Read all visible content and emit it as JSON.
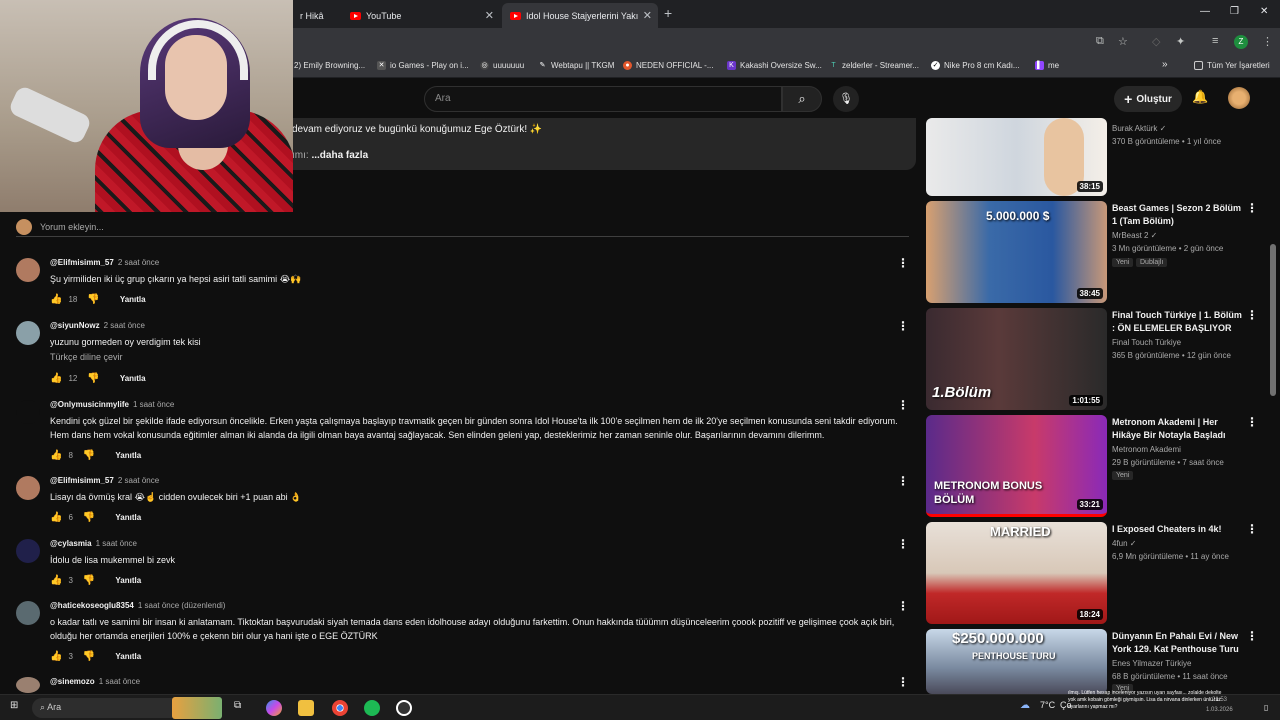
{
  "browser": {
    "tabs": [
      {
        "label": "r Hikâ"
      },
      {
        "label": "YouTube"
      },
      {
        "label": "Idol House Stajyerlerini Yakında"
      }
    ],
    "new_tab": "+",
    "bookmarks": [
      "2) Emily Browning...",
      "io Games - Play on i...",
      "uuuuuuu",
      "Webtapu || TKGM",
      "NEDEN OFFICIAL -...",
      "Kakashi Oversize Sw...",
      "zelderler - Streamer...",
      "Nike Pro 8 cm Kadı...",
      "me"
    ],
    "bookmarks_more": "»",
    "all_bookmarks": "Tüm Yer İşaretleri",
    "profile_letter": "Z"
  },
  "youtube": {
    "search_placeholder": "Ara",
    "create_label": "Oluştur",
    "description_line": "devam ediyoruz ve bugünkü konuğumuz Ege Öztürk! ✨",
    "description_more_prefix": "ımı: ",
    "description_more": "...daha fazla",
    "add_comment": "Yorum ekleyin...",
    "comments": [
      {
        "user": "@Elifmisimm_57",
        "time": "2 saat önce",
        "text": "Şu yirmiliden iki üç grup çıkarın ya hepsi asiri tatli samimi 😭🙌",
        "likes": "18",
        "reply": "Yanıtla",
        "avatar": "#b07a60"
      },
      {
        "user": "@siyunNowz",
        "time": "2 saat önce",
        "text": "yuzunu gormeden oy verdigim tek kisi",
        "translate": "Türkçe diline çevir",
        "likes": "12",
        "reply": "Yanıtla",
        "avatar": "#8aa0a8"
      },
      {
        "user": "@Onlymusicinmylife",
        "time": "1 saat önce",
        "text": "Kendini çok güzel bir şekilde ifade ediyorsun öncelikle. Erken yaşta çalışmaya başlayıp travmatik geçen bir günden sonra Idol House'ta ilk 100'e seçilmen hem de ilk 20'ye seçilmen konusunda seni takdir ediyorum. Hem dans hem vokal konusunda eğitimler alman iki alanda da ilgili olman baya avantaj sağlayacak. Sen elinden geleni yap, desteklerimiz her zaman seninle olur. Başarılarının devamını dilerimm.",
        "likes": "8",
        "reply": "Yanıtla",
        "avatar": "#0f0f0f"
      },
      {
        "user": "@Elifmisimm_57",
        "time": "2 saat önce",
        "text": "Lisayı da övmüş kral 😭☝️ cidden ovulecek biri +1 puan abi 👌",
        "likes": "6",
        "reply": "Yanıtla",
        "avatar": "#b07a60"
      },
      {
        "user": "@cylasmia",
        "time": "1 saat önce",
        "text": "İdolu de lisa mukemmel bi zevk",
        "likes": "3",
        "reply": "Yanıtla",
        "avatar": "#20204a"
      },
      {
        "user": "@haticekoseoglu8354",
        "time": "1 saat önce (düzenlendi)",
        "text": "o kadar tatlı ve samimi bir insan ki anlatamam. Tiktoktan başvurudaki siyah temada dans eden idolhouse adayı olduğunu farkettim. Onun hakkında tüüümm düşünceleerim çoook pozitiff ve gelişimee çook açık biri, olduğu her ortamda enerjileri 100% e çekenn biri olur ya hani işte o EGE ÖZTÜRK",
        "likes": "3",
        "reply": "Yanıtla",
        "avatar": "#5a6a70"
      },
      {
        "user": "@sinemozo",
        "time": "1 saat önce",
        "avatar": "#9a8070"
      }
    ],
    "recommended": [
      {
        "title": "",
        "channel": "Burak Aktürk ✓",
        "meta": "370 B görüntüleme • 1 yıl önce",
        "duration": "38:15"
      },
      {
        "title": "Beast Games | Sezon 2 Bölüm 1 (Tam Bölüm)",
        "channel": "MrBeast 2 ✓",
        "meta": "3 Mn görüntüleme • 2 gün önce",
        "badges": [
          "Yeni",
          "Dublajlı"
        ],
        "duration": "38:45",
        "overlay": "5.000.000 $"
      },
      {
        "title": "Final Touch Türkiye | 1. Bölüm : ÖN ELEMELER BAŞLIYOR",
        "channel": "Final Touch Türkiye",
        "meta": "365 B görüntüleme • 12 gün önce",
        "duration": "1:01:55",
        "overlay": "1.Bölüm"
      },
      {
        "title": "Metronom Akademi | Her Hikâye Bir Notayla Başladı",
        "channel": "Metronom Akademi",
        "meta": "29 B görüntüleme • 7 saat önce",
        "badges": [
          "Yeni"
        ],
        "duration": "33:21",
        "overlay": "METRONOM BONUS BÖLÜM"
      },
      {
        "title": "I Exposed Cheaters in 4k!",
        "channel": "4fun ✓",
        "meta": "6,9 Mn görüntüleme • 11 ay önce",
        "duration": "18:24",
        "overlay": "MARRIED"
      },
      {
        "title": "Dünyanın En Pahalı Evi / New York 129. Kat Penthouse Turu",
        "channel": "Enes Yilmazer Türkiye",
        "meta": "68 B görüntüleme • 11 saat önce",
        "badges": [
          "Yeni"
        ],
        "overlay": "$250.000.000",
        "overlay2": "PENTHOUSE TURU"
      }
    ]
  },
  "taskbar": {
    "search": "Ara",
    "weather": "7°C",
    "weather_short": "Ço",
    "time": "21:53",
    "date": "1.03.2026",
    "notification": "ılmış. Lütfen hesap inceleniyor yazısın uyarı sayfası... zolalde dekolte yok amk kobain gömleği giymişsin. Lisa da nirvana dinlerken ünlü tüz ayarlarını yapmaz mı?"
  }
}
